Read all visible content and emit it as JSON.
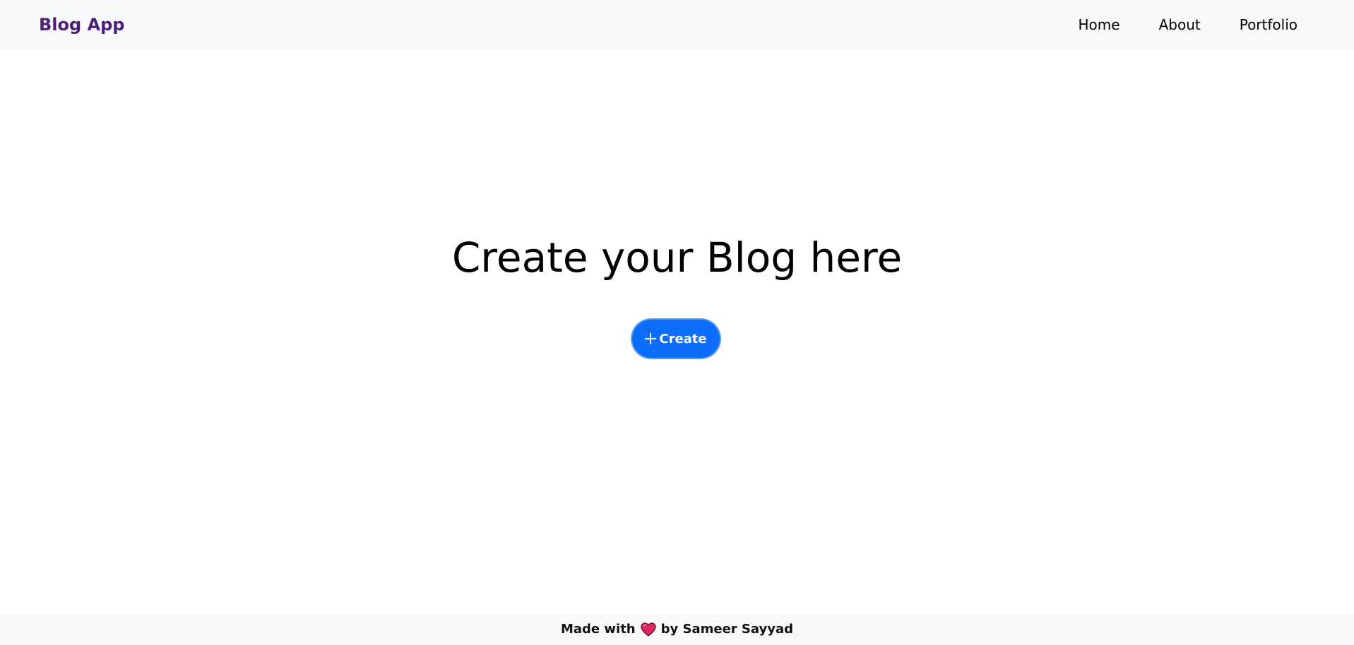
{
  "navbar": {
    "brand": "Blog App",
    "links": [
      {
        "label": "Home"
      },
      {
        "label": "About"
      },
      {
        "label": "Portfolio"
      }
    ]
  },
  "hero": {
    "title": "Create your Blog here",
    "button_label": "Create",
    "button_icon": "plus-icon"
  },
  "footer": {
    "prefix": "Made with",
    "icon": "heart-icon",
    "suffix": "by Sameer Sayyad"
  },
  "colors": {
    "brand": "#4b1f7a",
    "accent": "#0d6efd",
    "heart": "#e0245e",
    "bar_background": "#f8f9fa"
  }
}
